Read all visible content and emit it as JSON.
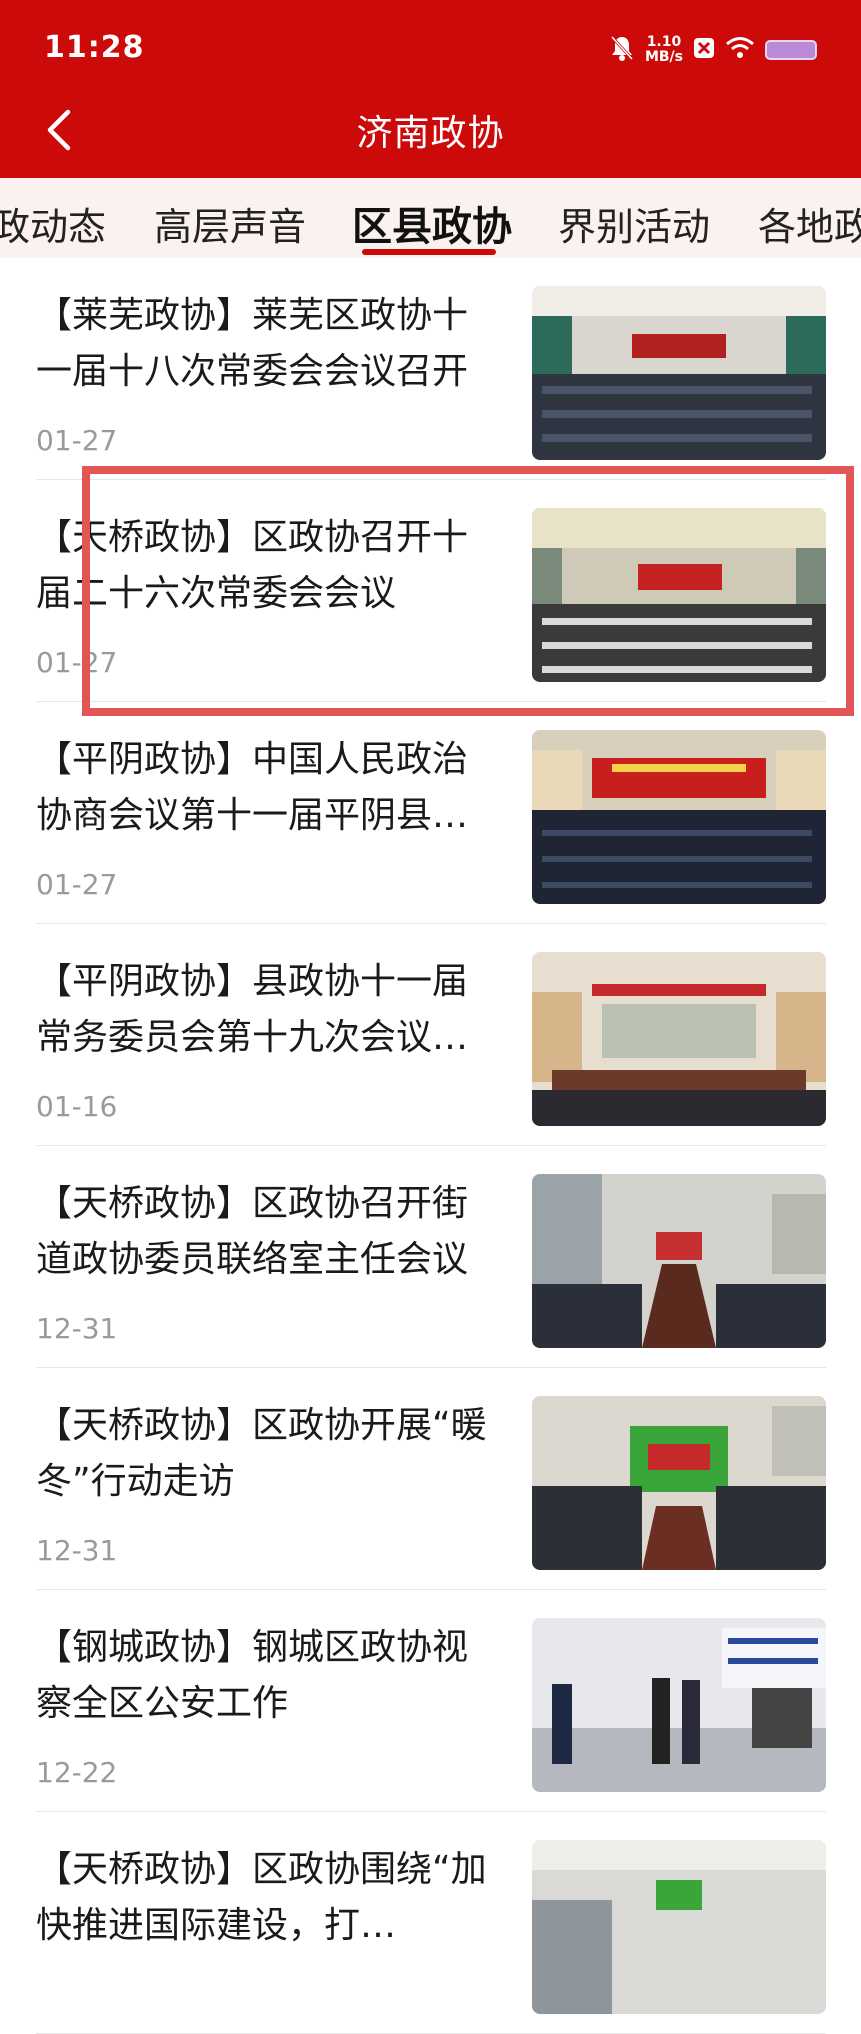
{
  "status_bar": {
    "time": "11:28",
    "net_speed_value": "1.10",
    "net_speed_unit": "MB/s"
  },
  "header": {
    "title": "济南政协",
    "back_icon": "chevron-left-icon",
    "color": "#cc0a0a"
  },
  "tabs": [
    {
      "label": "政动态"
    },
    {
      "label": "高层声音"
    },
    {
      "label": "区县政协",
      "active": true
    },
    {
      "label": "界别活动"
    },
    {
      "label": "各地政"
    }
  ],
  "news": [
    {
      "title": "【莱芜政协】莱芜区政协十一届十八次常委会会议召开",
      "date": "01-27"
    },
    {
      "title": "【天桥政协】区政协召开十届二十六次常委会会议",
      "date": "01-27"
    },
    {
      "title": "【平阴政协】中国人民政治协商会议第十一届平阴县…",
      "date": "01-27"
    },
    {
      "title": "【平阴政协】县政协十一届常务委员会第十九次会议…",
      "date": "01-16"
    },
    {
      "title": "【天桥政协】区政协召开街道政协委员联络室主任会议",
      "date": "12-31"
    },
    {
      "title": "【天桥政协】区政协开展“暖冬”行动走访",
      "date": "12-31"
    },
    {
      "title": "【钢城政协】钢城区政协视察全区公安工作",
      "date": "12-22"
    },
    {
      "title": "【天桥政协】区政协围绕“加快推进国际建设，打…",
      "date": ""
    }
  ]
}
